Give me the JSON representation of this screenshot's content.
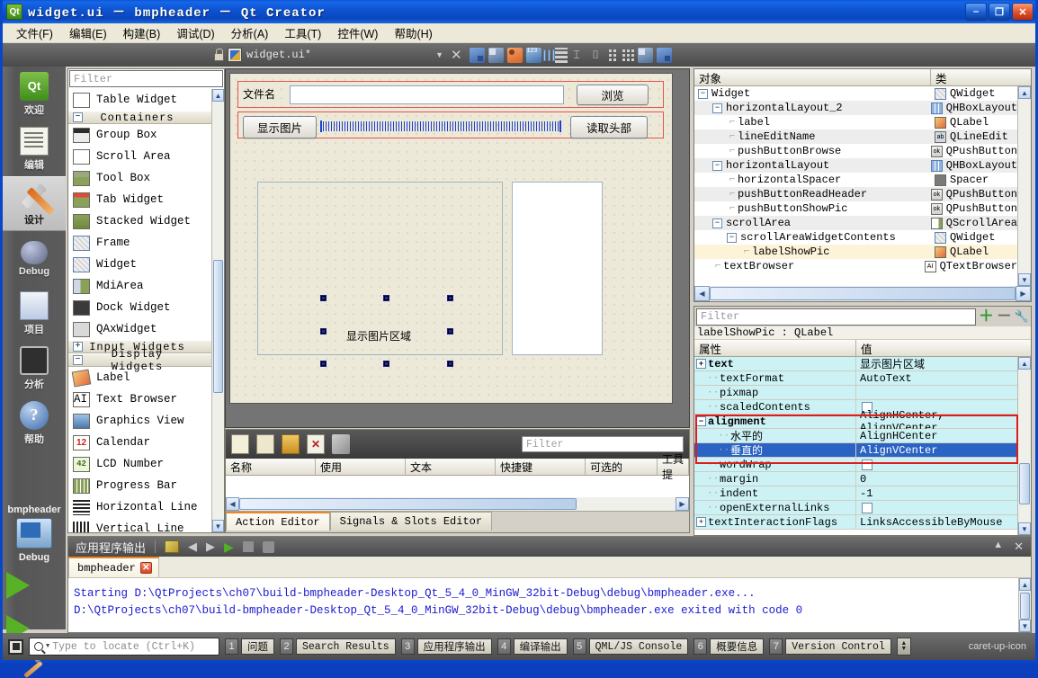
{
  "window": {
    "title": "widget.ui － bmpheader － Qt Creator",
    "app_icon": "qt-icon",
    "buttons": {
      "minimize": "–",
      "maximize": "❐",
      "close": "✕"
    }
  },
  "menubar": {
    "items": [
      {
        "label": "文件(F)",
        "name": "menu-file"
      },
      {
        "label": "编辑(E)",
        "name": "menu-edit"
      },
      {
        "label": "构建(B)",
        "name": "menu-build"
      },
      {
        "label": "调试(D)",
        "name": "menu-debug"
      },
      {
        "label": "分析(A)",
        "name": "menu-analyze"
      },
      {
        "label": "工具(T)",
        "name": "menu-tools"
      },
      {
        "label": "控件(W)",
        "name": "menu-window"
      },
      {
        "label": "帮助(H)",
        "name": "menu-help"
      }
    ]
  },
  "editor_toolbar": {
    "filename": "widget.ui*",
    "dropdown_arrow": "▼",
    "close_label": "✕",
    "icons": [
      "edit-buddies-icon",
      "edit-tab-order-icon",
      "edit-signals-slots-icon",
      "edit-widgets-icon",
      "layout-horizontal-icon",
      "layout-vertical-icon",
      "layout-splitter-horizontal-icon",
      "layout-splitter-vertical-icon",
      "layout-form-icon",
      "layout-grid-icon",
      "break-layout-icon",
      "adjust-size-icon"
    ]
  },
  "modebar": {
    "modes": [
      {
        "label": "欢迎",
        "icon": "welcome-icon",
        "selected": false
      },
      {
        "label": "编辑",
        "icon": "edit-icon",
        "selected": false
      },
      {
        "label": "设计",
        "icon": "design-icon",
        "selected": true
      },
      {
        "label": "Debug",
        "icon": "debug-icon",
        "selected": false
      },
      {
        "label": "项目",
        "icon": "projects-icon",
        "selected": false
      },
      {
        "label": "分析",
        "icon": "analyze-icon",
        "selected": false
      },
      {
        "label": "帮助",
        "icon": "help-icon",
        "selected": false
      }
    ],
    "kit": {
      "project": "bmpheader",
      "config": "Debug",
      "icon": "target-selector-icon"
    },
    "run_icon": "run-icon",
    "debug_icon": "start-debug-icon",
    "build_icon": "build-hammer-icon"
  },
  "widgetbox": {
    "filter_placeholder": "Filter",
    "rows": [
      {
        "type": "item",
        "label": "Table Widget",
        "icon": "table-widget-icon"
      },
      {
        "type": "category",
        "label": "Containers",
        "expanded": true
      },
      {
        "type": "item",
        "label": "Group Box",
        "icon": "group-box-icon"
      },
      {
        "type": "item",
        "label": "Scroll Area",
        "icon": "scroll-area-icon"
      },
      {
        "type": "item",
        "label": "Tool Box",
        "icon": "tool-box-icon"
      },
      {
        "type": "item",
        "label": "Tab Widget",
        "icon": "tab-widget-icon"
      },
      {
        "type": "item",
        "label": "Stacked Widget",
        "icon": "stacked-widget-icon"
      },
      {
        "type": "item",
        "label": "Frame",
        "icon": "frame-icon"
      },
      {
        "type": "item",
        "label": "Widget",
        "icon": "widget-icon"
      },
      {
        "type": "item",
        "label": "MdiArea",
        "icon": "mdi-area-icon"
      },
      {
        "type": "item",
        "label": "Dock Widget",
        "icon": "dock-widget-icon"
      },
      {
        "type": "item",
        "label": "QAxWidget",
        "icon": "qax-widget-icon"
      },
      {
        "type": "category",
        "label": "Input Widgets",
        "expanded": false
      },
      {
        "type": "category",
        "label": "Display Widgets",
        "expanded": true
      },
      {
        "type": "item",
        "label": "Label",
        "icon": "label-icon"
      },
      {
        "type": "item",
        "label": "Text Browser",
        "icon": "text-browser-icon"
      },
      {
        "type": "item",
        "label": "Graphics View",
        "icon": "graphics-view-icon"
      },
      {
        "type": "item",
        "label": "Calendar",
        "icon": "calendar-icon"
      },
      {
        "type": "item",
        "label": "LCD Number",
        "icon": "lcd-number-icon"
      },
      {
        "type": "item",
        "label": "Progress Bar",
        "icon": "progress-bar-icon"
      },
      {
        "type": "item",
        "label": "Horizontal Line",
        "icon": "horizontal-line-icon"
      },
      {
        "type": "item",
        "label": "Vertical Line",
        "icon": "vertical-line-icon"
      }
    ]
  },
  "form": {
    "label_filename": "文件名",
    "lineedit_value": "",
    "button_browse": "浏览",
    "button_showpic": "显示图片",
    "button_readheader": "读取头部",
    "label_showpic": "显示图片区域"
  },
  "action_editor": {
    "filter_placeholder": "Filter",
    "columns": [
      "名称",
      "使用",
      "文本",
      "快捷键",
      "可选的",
      "工具提"
    ],
    "rows": [],
    "tabs": [
      {
        "label": "Action Editor",
        "selected": true
      },
      {
        "label": "Signals & Slots Editor",
        "selected": false
      }
    ],
    "toolbar_icons": [
      "new-action-icon",
      "copy-icon",
      "paste-icon",
      "delete-icon",
      "configure-icon"
    ]
  },
  "object_tree": {
    "columns": {
      "name": "对象",
      "class": "类"
    },
    "rows": [
      {
        "name": "Widget",
        "class": "QWidget",
        "depth": 0,
        "expander": "-",
        "icon": "qwidget-icon",
        "selected": false
      },
      {
        "name": "horizontalLayout_2",
        "class": "QHBoxLayout",
        "depth": 1,
        "expander": "-",
        "icon": "hboxlayout-icon",
        "selected": false
      },
      {
        "name": "label",
        "class": "QLabel",
        "depth": 2,
        "expander": "",
        "icon": "qlabel-icon",
        "selected": false
      },
      {
        "name": "lineEditName",
        "class": "QLineEdit",
        "depth": 2,
        "expander": "",
        "icon": "qlineedit-icon",
        "selected": false
      },
      {
        "name": "pushButtonBrowse",
        "class": "QPushButton",
        "depth": 2,
        "expander": "",
        "icon": "qpushbutton-icon",
        "selected": false
      },
      {
        "name": "horizontalLayout",
        "class": "QHBoxLayout",
        "depth": 1,
        "expander": "-",
        "icon": "hboxlayout-icon",
        "selected": false
      },
      {
        "name": "horizontalSpacer",
        "class": "Spacer",
        "depth": 2,
        "expander": "",
        "icon": "spacer-icon",
        "selected": false
      },
      {
        "name": "pushButtonReadHeader",
        "class": "QPushButton",
        "depth": 2,
        "expander": "",
        "icon": "qpushbutton-icon",
        "selected": false
      },
      {
        "name": "pushButtonShowPic",
        "class": "QPushButton",
        "depth": 2,
        "expander": "",
        "icon": "qpushbutton-icon",
        "selected": false
      },
      {
        "name": "scrollArea",
        "class": "QScrollArea",
        "depth": 1,
        "expander": "-",
        "icon": "qscrollarea-icon",
        "selected": false
      },
      {
        "name": "scrollAreaWidgetContents",
        "class": "QWidget",
        "depth": 2,
        "expander": "-",
        "icon": "qwidget-icon",
        "selected": false
      },
      {
        "name": "labelShowPic",
        "class": "QLabel",
        "depth": 3,
        "expander": "",
        "icon": "qlabel-icon",
        "selected": true
      },
      {
        "name": "textBrowser",
        "class": "QTextBrowser",
        "depth": 1,
        "expander": "",
        "icon": "qtextbrowser-icon",
        "selected": false
      }
    ]
  },
  "property_editor": {
    "filter_placeholder": "Filter",
    "object_header": "labelShowPic : QLabel",
    "add_icon": "plus-icon",
    "remove_icon": "minus-icon",
    "configure_icon": "wrench-icon",
    "columns": {
      "property": "属性",
      "value": "值"
    },
    "rows": [
      {
        "name": "text",
        "value": "显示图片区域",
        "expander": "+",
        "bold": true,
        "indent": 0,
        "kind": "text",
        "highlight": false,
        "selected": false
      },
      {
        "name": "textFormat",
        "value": "AutoText",
        "expander": "",
        "bold": false,
        "indent": 1,
        "kind": "text",
        "highlight": false,
        "selected": false
      },
      {
        "name": "pixmap",
        "value": "",
        "expander": "",
        "bold": false,
        "indent": 1,
        "kind": "text",
        "highlight": false,
        "selected": false
      },
      {
        "name": "scaledContents",
        "value": "",
        "expander": "",
        "bold": false,
        "indent": 1,
        "kind": "check",
        "highlight": false,
        "selected": false
      },
      {
        "name": "alignment",
        "value": "AlignHCenter, AlignVCenter",
        "expander": "-",
        "bold": true,
        "indent": 0,
        "kind": "text",
        "highlight": true,
        "selected": false
      },
      {
        "name": "水平的",
        "value": "AlignHCenter",
        "expander": "",
        "bold": false,
        "indent": 2,
        "kind": "text",
        "highlight": true,
        "selected": false
      },
      {
        "name": "垂直的",
        "value": "AlignVCenter",
        "expander": "",
        "bold": false,
        "indent": 2,
        "kind": "text",
        "highlight": true,
        "selected": true
      },
      {
        "name": "wordWrap",
        "value": "",
        "expander": "",
        "bold": false,
        "indent": 1,
        "kind": "check",
        "highlight": false,
        "selected": false
      },
      {
        "name": "margin",
        "value": "0",
        "expander": "",
        "bold": false,
        "indent": 1,
        "kind": "text",
        "highlight": false,
        "selected": false
      },
      {
        "name": "indent",
        "value": "-1",
        "expander": "",
        "bold": false,
        "indent": 1,
        "kind": "text",
        "highlight": false,
        "selected": false
      },
      {
        "name": "openExternalLinks",
        "value": "",
        "expander": "",
        "bold": false,
        "indent": 1,
        "kind": "check",
        "highlight": false,
        "selected": false
      },
      {
        "name": "textInteractionFlags",
        "value": "LinksAccessibleByMouse",
        "expander": "+",
        "bold": false,
        "indent": 0,
        "kind": "text",
        "highlight": false,
        "selected": false
      }
    ],
    "highlight_color": "#e01b1b"
  },
  "output_pane": {
    "title": "应用程序输出",
    "toolbar_icons": [
      "clear-icon",
      "prev-item-icon",
      "next-item-icon",
      "run-icon",
      "stop-icon",
      "attach-icon"
    ],
    "tabs": [
      {
        "label": "bmpheader",
        "selected": true,
        "close": "✕"
      }
    ],
    "lines": [
      "Starting D:\\QtProjects\\ch07\\build-bmpheader-Desktop_Qt_5_4_0_MinGW_32bit-Debug\\debug\\bmpheader.exe...",
      "D:\\QtProjects\\ch07\\build-bmpheader-Desktop_Qt_5_4_0_MinGW_32bit-Debug\\debug\\bmpheader.exe exited with code 0"
    ]
  },
  "statusbar": {
    "stop_icon": "stop-icon",
    "locate_placeholder": "Type to locate (Ctrl+K)",
    "search_icon": "search-icon",
    "panes": [
      {
        "num": "1",
        "label": "问题",
        "cjk": true
      },
      {
        "num": "2",
        "label": "Search Results",
        "cjk": false
      },
      {
        "num": "3",
        "label": "应用程序输出",
        "cjk": true
      },
      {
        "num": "4",
        "label": "编译输出",
        "cjk": true
      },
      {
        "num": "5",
        "label": "QML/JS Console",
        "cjk": false
      },
      {
        "num": "6",
        "label": "概要信息",
        "cjk": true
      },
      {
        "num": "7",
        "label": "Version Control",
        "cjk": false
      }
    ],
    "updown_icon": "updown-icon",
    "collapse_icon": "caret-up-icon"
  }
}
